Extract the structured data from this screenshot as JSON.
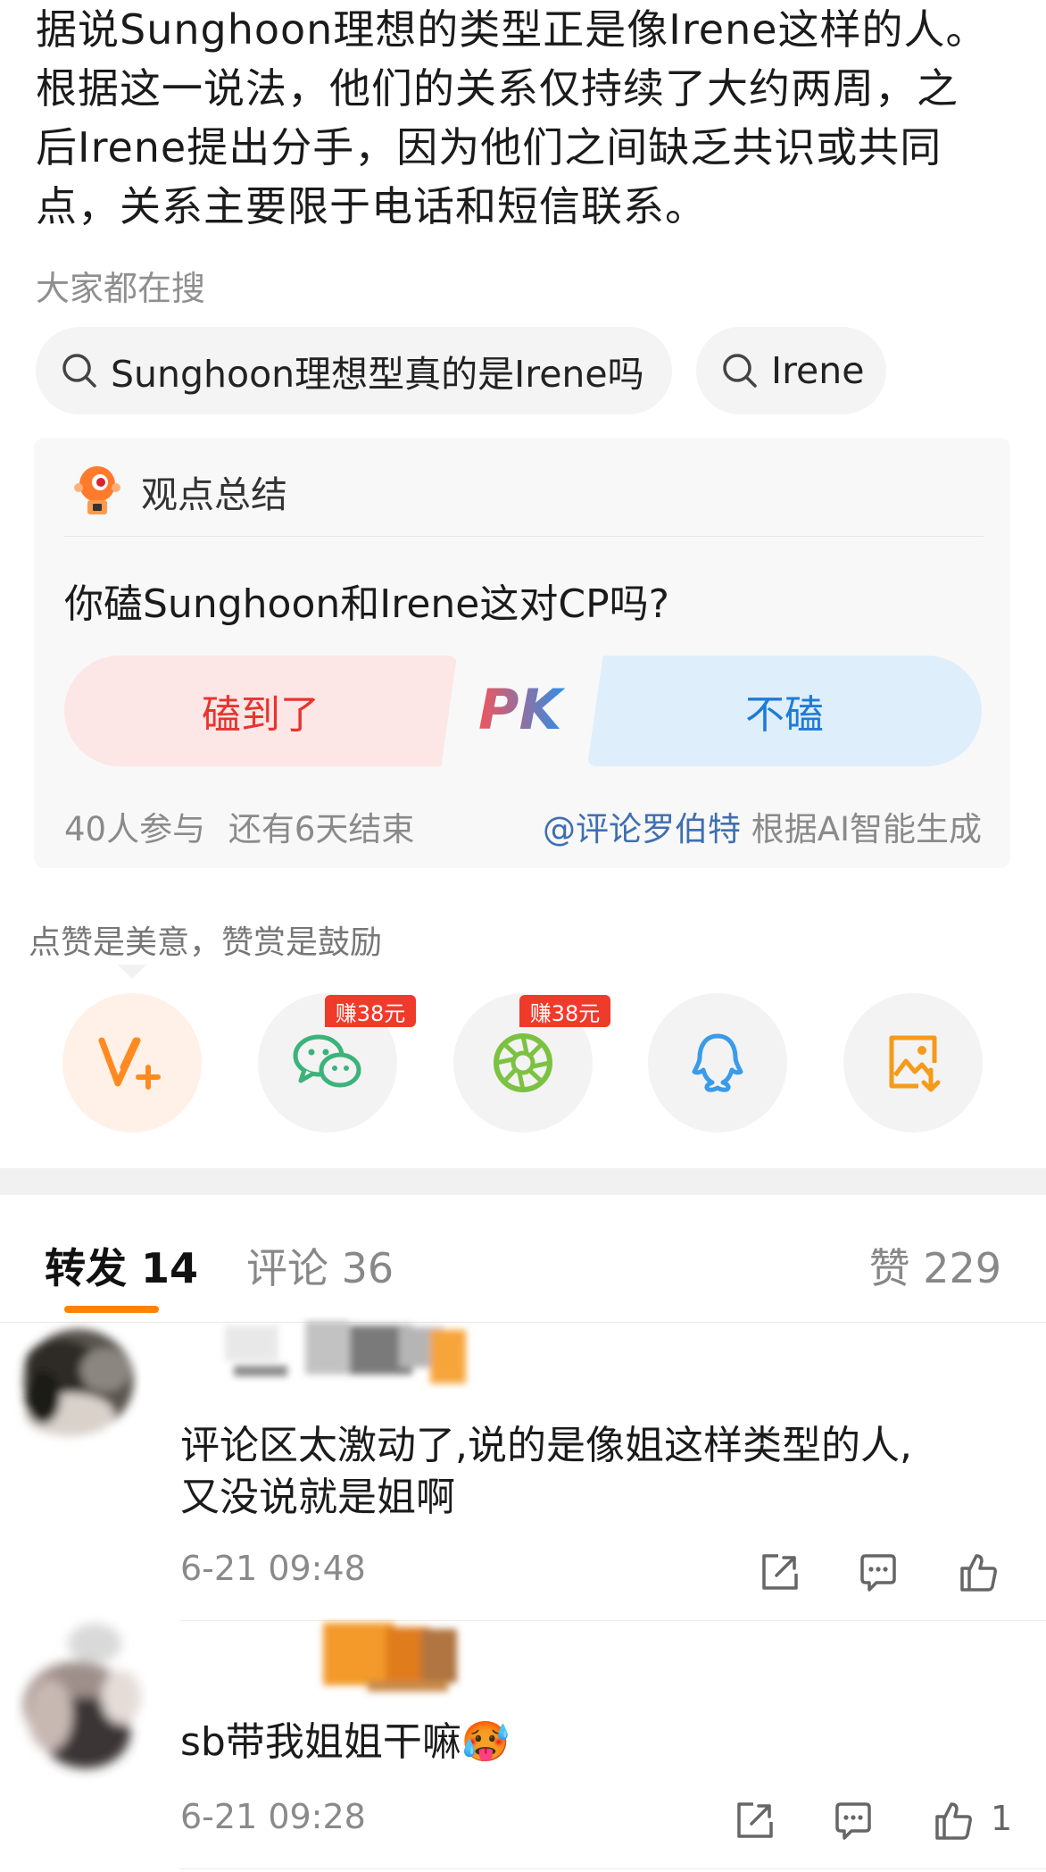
{
  "article": {
    "lines": [
      "据说Sunghoon理想的类型正是像Irene这样的人。",
      "根据这一说法，他们的关系仅持续了大约两周，之",
      "后Irene提出分手，因为他们之间缺乏共识或共同",
      "点，关系主要限于电话和短信联系。"
    ]
  },
  "search": {
    "title": "大家都在搜",
    "chips": [
      "Sunghoon理想型真的是Irene吗",
      "Irene"
    ]
  },
  "opinion": {
    "title": "观点总结",
    "question": "你磕Sunghoon和Irene这对CP吗?",
    "option_yes": "磕到了",
    "option_no": "不磕",
    "pk_label": "PK",
    "participants": "40人参与",
    "remaining": "还有6天结束",
    "author": "@评论罗伯特",
    "ai_note": "根据AI智能生成"
  },
  "share": {
    "hint": "点赞是美意，赞赏是鼓励",
    "earn_badge": "赚38元",
    "buttons": [
      "reward-v-icon",
      "wechat-icon",
      "moments-icon",
      "qq-icon",
      "save-image-icon"
    ],
    "colors": {
      "v": "#ff8a1f",
      "wechat": "#3bb37a",
      "moments": "#7cc241",
      "qq": "#3a9be8",
      "save": "#f59a1a"
    }
  },
  "tabs": {
    "repost": "转发 14",
    "comment": "评论 36",
    "like": "赞 229"
  },
  "comments": [
    {
      "text_line1": "评论区太激动了,说的是像姐这样类型的人,",
      "text_line2": "又没说就是姐啊",
      "time": "6-21 09:48",
      "likes": ""
    },
    {
      "text_line1": "sb带我姐姐干嘛🥵",
      "text_line2": "",
      "time": "6-21 09:28",
      "likes": "1"
    }
  ]
}
